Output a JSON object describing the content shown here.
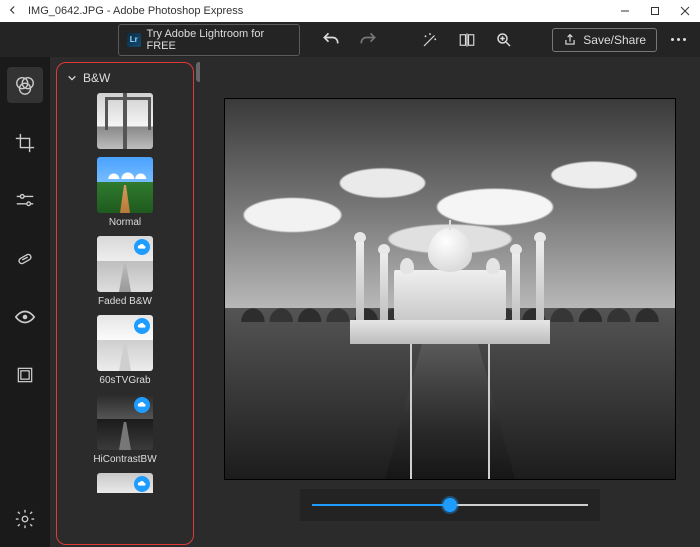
{
  "window": {
    "title": "IMG_0642.JPG - Adobe Photoshop Express"
  },
  "toolbar": {
    "promo_badge": "Lr",
    "promo_text": "Try Adobe Lightroom for FREE",
    "save_label": "Save/Share"
  },
  "rail": {
    "items": [
      {
        "name": "looks-icon",
        "active": true
      },
      {
        "name": "crop-icon",
        "active": false
      },
      {
        "name": "adjustments-icon",
        "active": false
      },
      {
        "name": "spot-heal-icon",
        "active": false
      },
      {
        "name": "eye-icon",
        "active": false
      },
      {
        "name": "border-icon",
        "active": false
      }
    ],
    "settings_name": "settings-icon"
  },
  "filters": {
    "category_label": "B&W",
    "items": [
      {
        "label": "",
        "thumb_class": "thumb-bridge",
        "cloud": false,
        "name": "filter-bw-default"
      },
      {
        "label": "Normal",
        "thumb_class": "thumb-normal",
        "cloud": false,
        "name": "filter-normal"
      },
      {
        "label": "Faded B&W",
        "thumb_class": "thumb-faded",
        "cloud": true,
        "name": "filter-faded-bw"
      },
      {
        "label": "60sTVGrab",
        "thumb_class": "thumb-60s",
        "cloud": true,
        "name": "filter-60stvgrab"
      },
      {
        "label": "HiContrastBW",
        "thumb_class": "thumb-hicon",
        "cloud": true,
        "name": "filter-hicontrastbw"
      }
    ],
    "partial_item": {
      "thumb_class": "thumb-partial-sky",
      "cloud": true,
      "name": "filter-partial"
    }
  },
  "slider": {
    "value": 50
  }
}
